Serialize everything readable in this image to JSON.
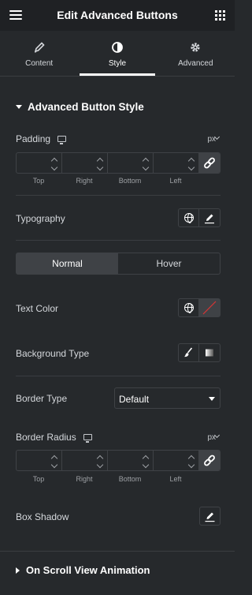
{
  "header": {
    "title": "Edit Advanced Buttons"
  },
  "tabs": [
    {
      "label": "Content",
      "icon": "pencil-icon"
    },
    {
      "label": "Style",
      "icon": "contrast-icon"
    },
    {
      "label": "Advanced",
      "icon": "gear-icon"
    }
  ],
  "section": {
    "title": "Advanced Button Style"
  },
  "padding": {
    "label": "Padding",
    "unit": "px",
    "fields": {
      "top": "Top",
      "right": "Right",
      "bottom": "Bottom",
      "left": "Left"
    }
  },
  "typography": {
    "label": "Typography"
  },
  "state_toggle": {
    "normal": "Normal",
    "hover": "Hover"
  },
  "text_color": {
    "label": "Text Color"
  },
  "background_type": {
    "label": "Background Type"
  },
  "border_type": {
    "label": "Border Type",
    "value": "Default"
  },
  "border_radius": {
    "label": "Border Radius",
    "unit": "px",
    "fields": {
      "top": "Top",
      "right": "Right",
      "bottom": "Bottom",
      "left": "Left"
    }
  },
  "box_shadow": {
    "label": "Box Shadow"
  },
  "section2": {
    "title": "On Scroll View Animation"
  },
  "colors": {
    "panel": "#26292c",
    "header": "#1f2124",
    "border": "#3f4246",
    "clear_swatch": "#d93333"
  }
}
